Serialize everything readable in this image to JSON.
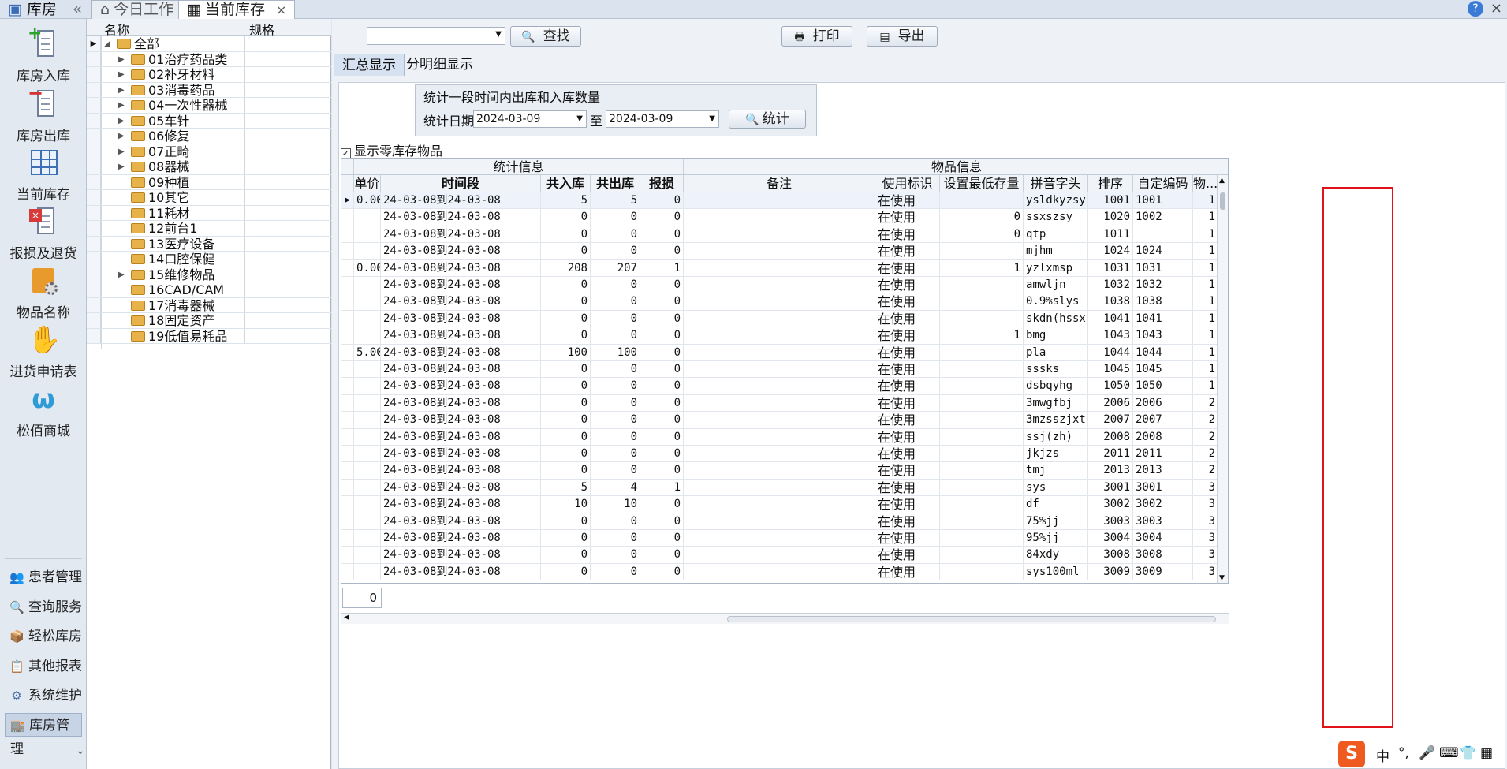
{
  "topbar": {
    "app_title": "库房",
    "collapse_glyph": "«",
    "tabs": [
      {
        "label": "今日工作",
        "icon": "home-icon",
        "active": false
      },
      {
        "label": "当前库存",
        "icon": "table-icon",
        "active": true,
        "close": "×"
      }
    ],
    "help": "?",
    "close": "×"
  },
  "nav": {
    "big_items": [
      {
        "label": "库房入库",
        "icon": "stock-in-icon"
      },
      {
        "label": "库房出库",
        "icon": "stock-out-icon"
      },
      {
        "label": "当前库存",
        "icon": "inventory-grid-icon"
      },
      {
        "label": "报损及退货",
        "icon": "loss-return-icon"
      },
      {
        "label": "物品名称",
        "icon": "item-names-icon"
      },
      {
        "label": "进货申请表",
        "icon": "purchase-request-icon"
      },
      {
        "label": "松佰商城",
        "icon": "mall-logo-icon"
      }
    ],
    "small_items": [
      {
        "label": "患者管理",
        "icon": "patients-icon",
        "glyph": "👥"
      },
      {
        "label": "查询服务",
        "icon": "query-icon",
        "glyph": "🔍"
      },
      {
        "label": "轻松库房",
        "icon": "easy-store-icon",
        "glyph": "📦"
      },
      {
        "label": "其他报表",
        "icon": "reports-icon",
        "glyph": "📋"
      },
      {
        "label": "系统维护",
        "icon": "system-icon",
        "glyph": "⚙"
      },
      {
        "label": "库房管理",
        "icon": "warehouse-icon",
        "glyph": "🏬",
        "active": true
      }
    ],
    "more_glyph": "⌄"
  },
  "tree": {
    "col_name": "名称",
    "col_spec": "规格",
    "root": "全部",
    "items": [
      {
        "label": "01治疗药品类",
        "expandable": true
      },
      {
        "label": "02补牙材料",
        "expandable": true
      },
      {
        "label": "03消毒药品",
        "expandable": true
      },
      {
        "label": "04一次性器械",
        "expandable": true
      },
      {
        "label": "05车针",
        "expandable": true
      },
      {
        "label": "06修复",
        "expandable": true
      },
      {
        "label": "07正畸",
        "expandable": true
      },
      {
        "label": "08器械",
        "expandable": true
      },
      {
        "label": "09种植",
        "expandable": false
      },
      {
        "label": "10其它",
        "expandable": false
      },
      {
        "label": "11耗材",
        "expandable": false
      },
      {
        "label": "12前台1",
        "expandable": false
      },
      {
        "label": "13医疗设备",
        "expandable": false
      },
      {
        "label": "14口腔保健",
        "expandable": false
      },
      {
        "label": "15维修物品",
        "expandable": true
      },
      {
        "label": "16CAD/CAM",
        "expandable": false
      },
      {
        "label": "17消毒器械",
        "expandable": false
      },
      {
        "label": "18固定资产",
        "expandable": false
      },
      {
        "label": "19低值易耗品",
        "expandable": false
      }
    ]
  },
  "toolbar": {
    "search_value": "",
    "search_label": "查找",
    "print_label": "打印",
    "export_label": "导出"
  },
  "subtabs": [
    {
      "label": "汇总显示",
      "active": true
    },
    {
      "label": "分明细显示",
      "active": false
    }
  ],
  "stats": {
    "title": "统计一段时间内出库和入库数量",
    "date_label": "统计日期",
    "from": "2024-03-09",
    "to_label": "至",
    "to": "2024-03-09",
    "button": "统计"
  },
  "show_zero": {
    "label": "显示零库存物品",
    "checked": true,
    "mark": "✓"
  },
  "grid": {
    "group1": "统计信息",
    "group2": "物品信息",
    "columns": [
      "单价",
      "时间段",
      "共入库",
      "共出库",
      "报损",
      "备注",
      "使用标识",
      "设置最低存量",
      "拼音字头",
      "排序",
      "自定编码",
      "物..."
    ],
    "rows": [
      [
        "0.00",
        "24-03-08到24-03-08",
        "5",
        "5",
        "0",
        "",
        "在使用",
        "",
        "ysldkyzsy",
        "1001",
        "1001",
        "1"
      ],
      [
        "",
        "24-03-08到24-03-08",
        "0",
        "0",
        "0",
        "",
        "在使用",
        "0",
        "ssxszsy",
        "1020",
        "1002",
        "1"
      ],
      [
        "",
        "24-03-08到24-03-08",
        "0",
        "0",
        "0",
        "",
        "在使用",
        "0",
        "qtp",
        "1011",
        "",
        "1"
      ],
      [
        "",
        "24-03-08到24-03-08",
        "0",
        "0",
        "0",
        "",
        "在使用",
        "",
        "mjhm",
        "1024",
        "1024",
        "1"
      ],
      [
        "0.00",
        "24-03-08到24-03-08",
        "208",
        "207",
        "1",
        "",
        "在使用",
        "1",
        "yzlxmsp",
        "1031",
        "1031",
        "1"
      ],
      [
        "",
        "24-03-08到24-03-08",
        "0",
        "0",
        "0",
        "",
        "在使用",
        "",
        "amwljn",
        "1032",
        "1032",
        "1"
      ],
      [
        "",
        "24-03-08到24-03-08",
        "0",
        "0",
        "0",
        "",
        "在使用",
        "",
        "0.9%slys",
        "1038",
        "1038",
        "1"
      ],
      [
        "",
        "24-03-08到24-03-08",
        "0",
        "0",
        "0",
        "",
        "在使用",
        "",
        "skdn(hssx",
        "1041",
        "1041",
        "1"
      ],
      [
        "",
        "24-03-08到24-03-08",
        "0",
        "0",
        "0",
        "",
        "在使用",
        "1",
        "bmg",
        "1043",
        "1043",
        "1"
      ],
      [
        "5.00",
        "24-03-08到24-03-08",
        "100",
        "100",
        "0",
        "",
        "在使用",
        "",
        "pla",
        "1044",
        "1044",
        "1"
      ],
      [
        "",
        "24-03-08到24-03-08",
        "0",
        "0",
        "0",
        "",
        "在使用",
        "",
        "sssks",
        "1045",
        "1045",
        "1"
      ],
      [
        "",
        "24-03-08到24-03-08",
        "0",
        "0",
        "0",
        "",
        "在使用",
        "",
        "dsbqyhg",
        "1050",
        "1050",
        "1"
      ],
      [
        "",
        "24-03-08到24-03-08",
        "0",
        "0",
        "0",
        "",
        "在使用",
        "",
        "3mwgfbj",
        "2006",
        "2006",
        "2"
      ],
      [
        "",
        "24-03-08到24-03-08",
        "0",
        "0",
        "0",
        "",
        "在使用",
        "",
        "3mzsszjxt",
        "2007",
        "2007",
        "2"
      ],
      [
        "",
        "24-03-08到24-03-08",
        "0",
        "0",
        "0",
        "",
        "在使用",
        "",
        "ssj(zh)",
        "2008",
        "2008",
        "2"
      ],
      [
        "",
        "24-03-08到24-03-08",
        "0",
        "0",
        "0",
        "",
        "在使用",
        "",
        "jkjzs",
        "2011",
        "2011",
        "2"
      ],
      [
        "",
        "24-03-08到24-03-08",
        "0",
        "0",
        "0",
        "",
        "在使用",
        "",
        "tmj",
        "2013",
        "2013",
        "2"
      ],
      [
        "",
        "24-03-08到24-03-08",
        "5",
        "4",
        "1",
        "",
        "在使用",
        "",
        "sys",
        "3001",
        "3001",
        "3"
      ],
      [
        "",
        "24-03-08到24-03-08",
        "10",
        "10",
        "0",
        "",
        "在使用",
        "",
        "df",
        "3002",
        "3002",
        "3"
      ],
      [
        "",
        "24-03-08到24-03-08",
        "0",
        "0",
        "0",
        "",
        "在使用",
        "",
        "75%jj",
        "3003",
        "3003",
        "3"
      ],
      [
        "",
        "24-03-08到24-03-08",
        "0",
        "0",
        "0",
        "",
        "在使用",
        "",
        "95%jj",
        "3004",
        "3004",
        "3"
      ],
      [
        "",
        "24-03-08到24-03-08",
        "0",
        "0",
        "0",
        "",
        "在使用",
        "",
        "84xdy",
        "3008",
        "3008",
        "3"
      ],
      [
        "",
        "24-03-08到24-03-08",
        "0",
        "0",
        "0",
        "",
        "在使用",
        "",
        "sys100ml",
        "3009",
        "3009",
        "3"
      ]
    ],
    "count": "0"
  },
  "ime": {
    "logo": "S",
    "lang": "中",
    "punct": "°,",
    "mic": "🎤",
    "kbd": "⌨",
    "shirt": "👕",
    "apps": "▦"
  },
  "colors": {
    "highlight_box": "#e0121a",
    "selected_nav": "#c7d4e6"
  }
}
